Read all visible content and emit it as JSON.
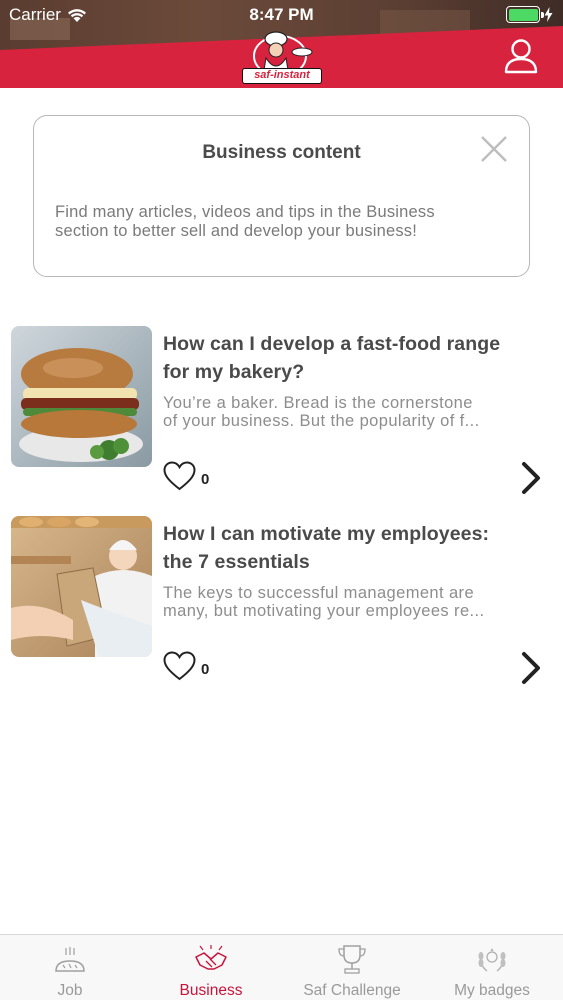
{
  "status": {
    "carrier": "Carrier",
    "time": "8:47 PM"
  },
  "header": {
    "logo_text": "saf-instant",
    "brand_color": "#d8233f",
    "icons": [
      "profile-icon"
    ]
  },
  "info_card": {
    "title": "Business content",
    "text_line1": "Find many articles, videos and tips in the Business",
    "text_line2": "section to better sell and develop your business!"
  },
  "articles": [
    {
      "title_line1": "How can I develop a fast-food range",
      "title_line2": "for my bakery?",
      "excerpt_line1": "You’re a baker. Bread is the cornerstone",
      "excerpt_line2": "of your business. But the popularity of f...",
      "likes": "0"
    },
    {
      "title_line1": "How I can motivate my employees:",
      "title_line2": "the 7 essentials",
      "excerpt_line1": "The keys to successful management are",
      "excerpt_line2": "many, but motivating your employees re...",
      "likes": "0"
    }
  ],
  "tabs": [
    {
      "label": "Job",
      "icon": "bread-icon",
      "active": false
    },
    {
      "label": "Business",
      "icon": "handshake-icon",
      "active": true
    },
    {
      "label": "Saf Challenge",
      "icon": "trophy-icon",
      "active": false
    },
    {
      "label": "My badges",
      "icon": "laurel-icon",
      "active": false
    }
  ],
  "colors": {
    "accent": "#c8143b",
    "battery": "#4cd964"
  }
}
